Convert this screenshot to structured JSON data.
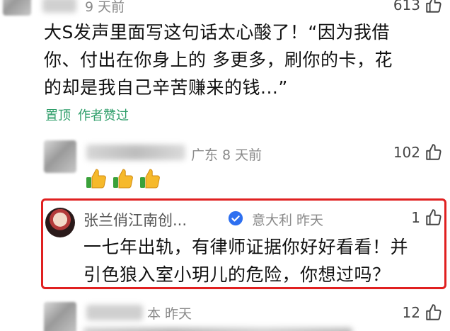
{
  "comments": [
    {
      "time": "9 天前",
      "likes": "613",
      "text_lines": [
        "大S发声里面写这句话太心酸了！“因为我借",
        "你、付出在你身上的 多更多，刷你的卡，花",
        "的却是我自己辛苦赚来的钱...”"
      ],
      "tags": [
        "置顶",
        "作者赞过"
      ]
    },
    {
      "location_time": "广东 8 天前",
      "likes": "102",
      "emoji_count": 3
    },
    {
      "name": "张兰俏江南创...",
      "location_time": "意大利 昨天",
      "likes": "1",
      "text_lines": [
        "一七年出轨，有律师证据你好好看看！并",
        "引色狼入室小玥儿的危险，你想过吗？"
      ]
    },
    {
      "location_time": "本 昨天",
      "likes": "12"
    }
  ],
  "icons": {
    "like": "thumbs-up-icon",
    "emoji": "thumbs-up-emoji-icon",
    "verified": "verified-badge-icon"
  },
  "colors": {
    "tag_green": "#2f9e6a",
    "highlight_red": "#e02020",
    "verified_blue": "#2d6ff0"
  }
}
